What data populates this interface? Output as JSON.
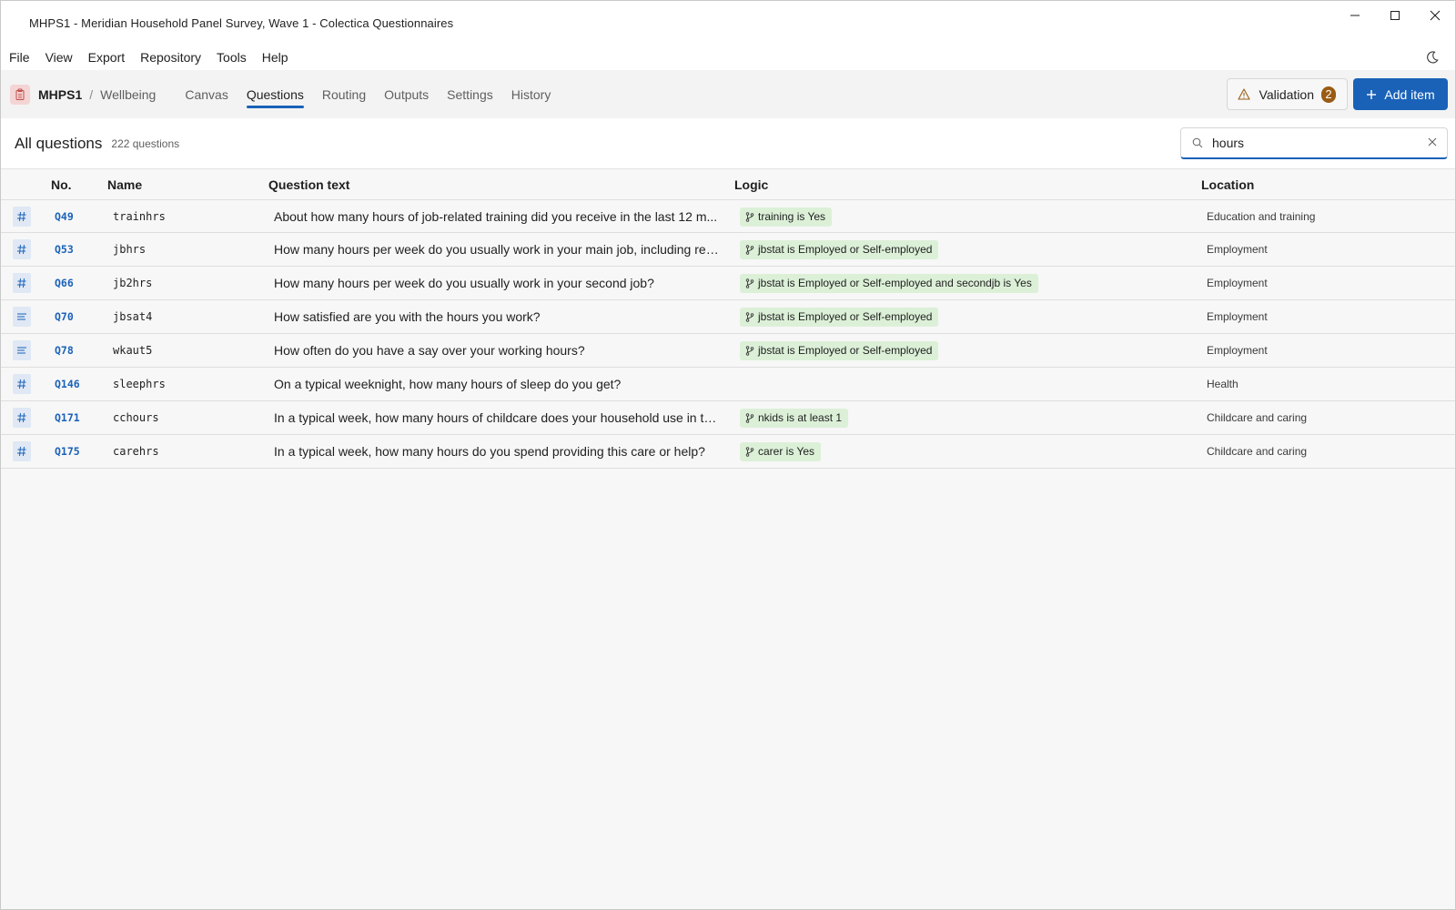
{
  "window": {
    "title": "MHPS1 - Meridian Household Panel Survey, Wave 1 - Colectica Questionnaires"
  },
  "menu": {
    "items": [
      "File",
      "View",
      "Export",
      "Repository",
      "Tools",
      "Help"
    ]
  },
  "toolbar": {
    "code": "MHPS1",
    "separator": "/",
    "section": "Wellbeing",
    "tabs": [
      {
        "label": "Canvas",
        "active": false
      },
      {
        "label": "Questions",
        "active": true
      },
      {
        "label": "Routing",
        "active": false
      },
      {
        "label": "Outputs",
        "active": false
      },
      {
        "label": "Settings",
        "active": false
      },
      {
        "label": "History",
        "active": false
      }
    ],
    "validation_label": "Validation",
    "validation_count": "2",
    "add_label": "Add item"
  },
  "list": {
    "title": "All questions",
    "count": "222 questions",
    "search_value": "hours"
  },
  "table": {
    "columns": {
      "no": "No.",
      "name": "Name",
      "text": "Question text",
      "logic": "Logic",
      "location": "Location"
    },
    "rows": [
      {
        "type": "numeric",
        "no": "Q49",
        "name": "trainhrs",
        "text": "About how many hours of job-related training did you receive in the last 12 m...",
        "logic": "training is Yes",
        "location": "Education and training"
      },
      {
        "type": "numeric",
        "no": "Q53",
        "name": "jbhrs",
        "text": "How many hours per week do you usually work in your main job, including reg...",
        "logic": "jbstat is Employed or Self-employed",
        "location": "Employment"
      },
      {
        "type": "numeric",
        "no": "Q66",
        "name": "jb2hrs",
        "text": "How many hours per week do you usually work in your second job?",
        "logic": "jbstat is Employed or Self-employed and secondjb is Yes",
        "location": "Employment"
      },
      {
        "type": "choice",
        "no": "Q70",
        "name": "jbsat4",
        "text": "How satisfied are you with the hours you work?",
        "logic": "jbstat is Employed or Self-employed",
        "location": "Employment"
      },
      {
        "type": "choice",
        "no": "Q78",
        "name": "wkaut5",
        "text": "How often do you have a say over your working hours?",
        "logic": "jbstat is Employed or Self-employed",
        "location": "Employment"
      },
      {
        "type": "numeric",
        "no": "Q146",
        "name": "sleephrs",
        "text": "On a typical weeknight, how many hours of sleep do you get?",
        "logic": "",
        "location": "Health"
      },
      {
        "type": "numeric",
        "no": "Q171",
        "name": "cchours",
        "text": "In a typical week, how many hours of childcare does your household use in tot...",
        "logic": "nkids is at least 1",
        "location": "Childcare and caring"
      },
      {
        "type": "numeric",
        "no": "Q175",
        "name": "carehrs",
        "text": "In a typical week, how many hours do you spend providing this care or help?",
        "logic": "carer is Yes",
        "location": "Childcare and caring"
      }
    ]
  },
  "colors": {
    "accent": "#1a62b8",
    "logic_chip": "#dcf0d8",
    "badge": "#9a5b13",
    "doc_icon_bg": "#f4d4d4"
  }
}
